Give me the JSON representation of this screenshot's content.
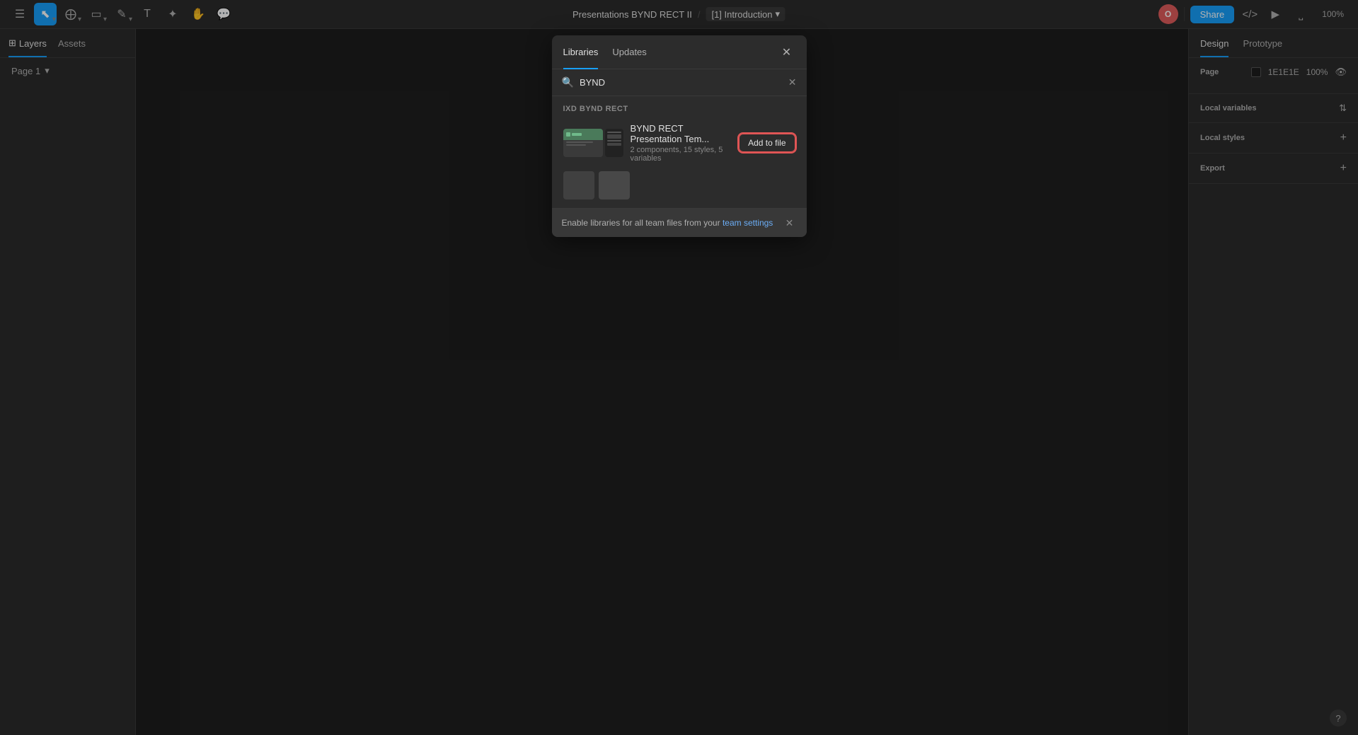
{
  "toolbar": {
    "file_name": "Presentations BYND RECT II",
    "separator": "/",
    "page_badge": "[1] Introduction",
    "share_label": "Share",
    "zoom_level": "100%",
    "tools": [
      {
        "name": "main-menu",
        "icon": "☰",
        "has_arrow": false
      },
      {
        "name": "move-tool",
        "icon": "↖",
        "has_arrow": true,
        "active": true
      },
      {
        "name": "scale-tool",
        "icon": "⊹",
        "has_arrow": true
      },
      {
        "name": "frame-tool",
        "icon": "▭",
        "has_arrow": true
      },
      {
        "name": "pen-tool",
        "icon": "✏",
        "has_arrow": true
      },
      {
        "name": "text-tool",
        "icon": "T",
        "has_arrow": false
      },
      {
        "name": "component-tool",
        "icon": "❖",
        "has_arrow": false
      },
      {
        "name": "hand-tool",
        "icon": "✋",
        "has_arrow": false
      },
      {
        "name": "comment-tool",
        "icon": "💬",
        "has_arrow": false
      }
    ],
    "avatar_initials": "O",
    "code_icon": "</>",
    "present_icon": "▷",
    "zoom_icon": "⋯"
  },
  "left_sidebar": {
    "tabs": [
      {
        "label": "Layers",
        "active": true,
        "icon": "⊞"
      },
      {
        "label": "Assets",
        "active": false
      }
    ],
    "page_section_label": "Page 1",
    "page_dropdown_icon": "▾"
  },
  "right_sidebar": {
    "tabs": [
      {
        "label": "Design",
        "active": true
      },
      {
        "label": "Prototype",
        "active": false
      }
    ],
    "page_section": {
      "title": "Page",
      "color_value": "1E1E1E",
      "opacity_value": "100%"
    },
    "local_variables": {
      "title": "Local variables",
      "sort_icon": "⇅"
    },
    "local_styles": {
      "title": "Local styles",
      "plus_icon": "+"
    },
    "export": {
      "title": "Export",
      "plus_icon": "+"
    }
  },
  "modal": {
    "tabs": [
      {
        "label": "Libraries",
        "active": true
      },
      {
        "label": "Updates",
        "active": false
      }
    ],
    "close_icon": "✕",
    "search_placeholder": "Search",
    "search_value": "BYND",
    "clear_icon": "✕",
    "section_title": "IXD BYND RECT",
    "library_item": {
      "name": "BYND RECT Presentation Tem...",
      "meta": "2 components, 15 styles, 5 variables",
      "add_button_label": "Add to file"
    }
  },
  "footer": {
    "enable_text": "Enable libraries for all team files from your",
    "link_text": "team settings",
    "close_icon": "✕"
  },
  "question": {
    "icon": "?"
  }
}
